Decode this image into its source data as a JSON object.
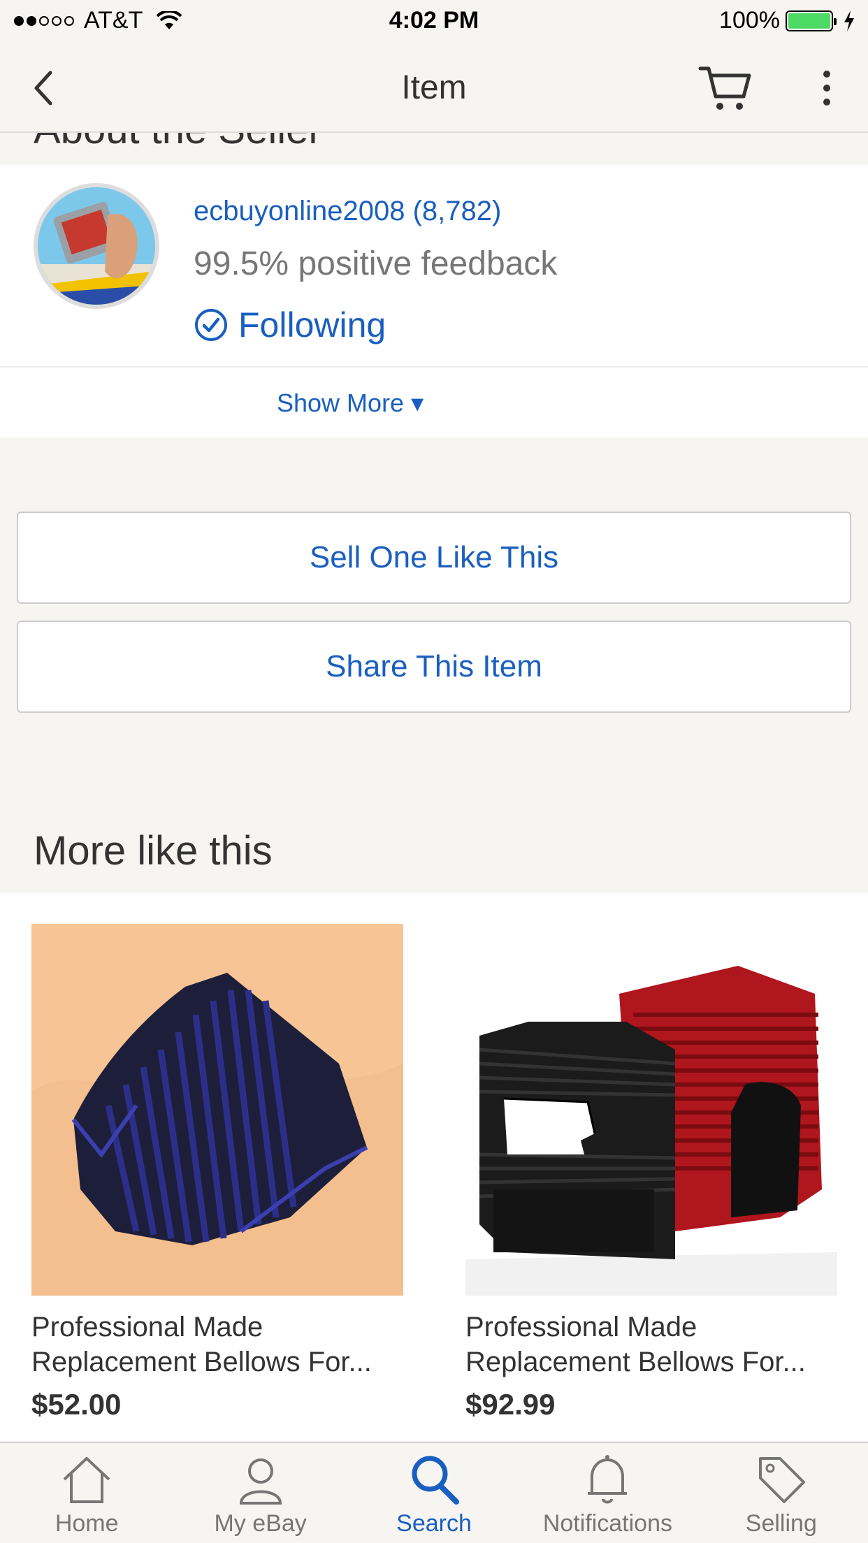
{
  "status_bar": {
    "carrier": "AT&T",
    "time": "4:02 PM",
    "battery": "100%"
  },
  "nav": {
    "title": "Item"
  },
  "peek_header": "About the Seller",
  "seller": {
    "name": "ecbuyonline2008 (8,782)",
    "feedback": "99.5% positive feedback",
    "following_label": "Following",
    "show_more": "Show More ▾"
  },
  "actions": {
    "sell_one": "Sell One Like This",
    "share": "Share This Item"
  },
  "more_like_this": {
    "title": "More like this",
    "items": [
      {
        "title_line1": "Professional Made",
        "title_line2": "Replacement Bellows For...",
        "price": "$52.00"
      },
      {
        "title_line1": "Professional Made",
        "title_line2": "Replacement Bellows For...",
        "price": "$92.99"
      }
    ]
  },
  "tabbar": {
    "items": [
      {
        "label": "Home",
        "icon": "home-icon"
      },
      {
        "label": "My eBay",
        "icon": "person-icon"
      },
      {
        "label": "Search",
        "icon": "search-icon"
      },
      {
        "label": "Notifications",
        "icon": "bell-icon"
      },
      {
        "label": "Selling",
        "icon": "tag-icon"
      }
    ],
    "active": "Search"
  },
  "colors": {
    "link_blue": "#1a5fc0",
    "background": "#f6f5f2",
    "battery_green": "#4cd964"
  }
}
